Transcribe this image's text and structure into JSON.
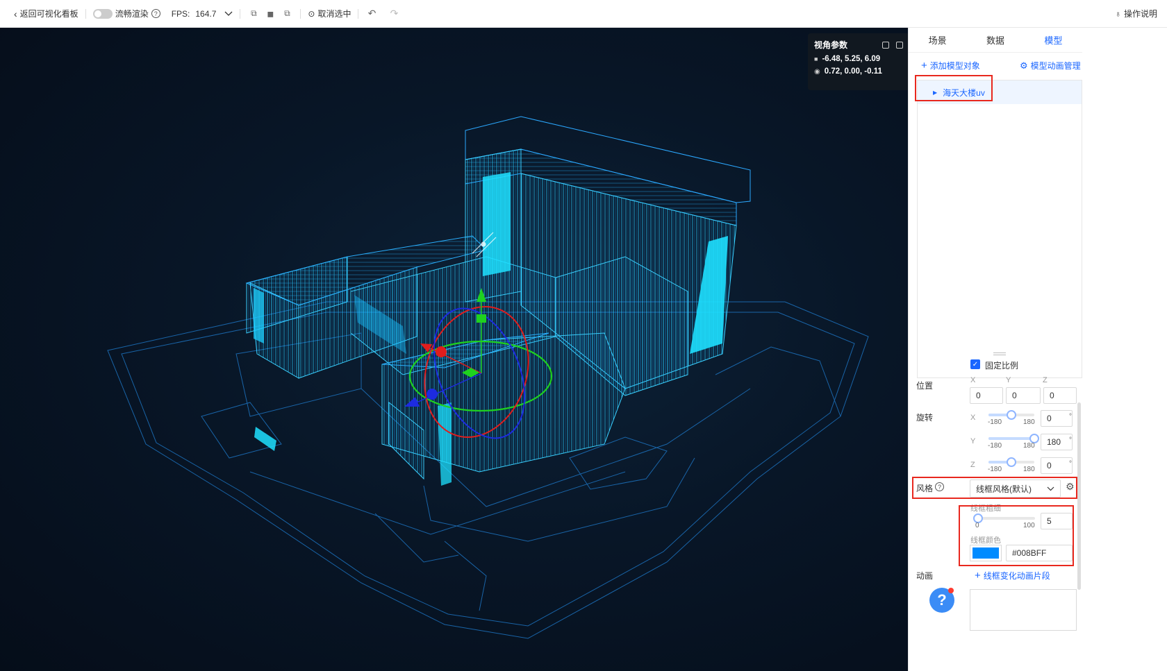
{
  "toolbar": {
    "back_label": "返回可视化看板",
    "smooth_render_label": "流畅渲染",
    "fps_label": "FPS:",
    "fps_value": "164.7",
    "deselect_label": "取消选中",
    "help_label": "操作说明"
  },
  "camera": {
    "title": "视角参数",
    "position": "-6.48, 5.25, 6.09",
    "target": "0.72, 0.00, -0.11"
  },
  "tabs": [
    {
      "label": "场景",
      "active": false
    },
    {
      "label": "数据",
      "active": false
    },
    {
      "label": "模型",
      "active": true
    }
  ],
  "model_panel": {
    "add_model_label": "添加模型对象",
    "anim_manage_label": "模型动画管理",
    "tree_item": "海天大楼uv",
    "lock_ratio_label": "固定比例",
    "position_label": "位置",
    "axes": [
      "X",
      "Y",
      "Z"
    ],
    "position_values": [
      "0",
      "0",
      "0"
    ],
    "rotation_label": "旋转",
    "rotation": [
      {
        "axis": "X",
        "min": "-180",
        "max": "180",
        "value": "0",
        "unit": "°",
        "level": 0.5
      },
      {
        "axis": "Y",
        "min": "-180",
        "max": "180",
        "value": "180",
        "unit": "°",
        "level": 1.0
      },
      {
        "axis": "Z",
        "min": "-180",
        "max": "180",
        "value": "0",
        "unit": "°",
        "level": 0.5
      }
    ],
    "style_label": "风格",
    "style_value": "线框风格(默认)",
    "wire_width_label": "线框粗细",
    "wire_width_min": "0",
    "wire_width_max": "100",
    "wire_width_value": "5",
    "wire_width_level": 0.05,
    "wire_color_label": "线框颜色",
    "wire_color_value": "#008BFF",
    "animation_label": "动画",
    "add_wire_anim_label": "线框变化动画片段"
  },
  "colors": {
    "accent": "#1a66ff",
    "wire": "#008BFF",
    "highlight": "#e8281e"
  }
}
